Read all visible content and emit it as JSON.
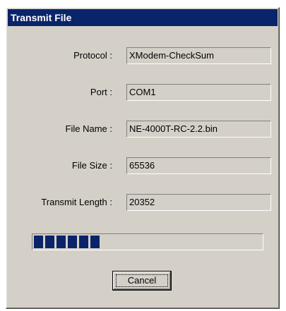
{
  "window": {
    "title": "Transmit File"
  },
  "fields": {
    "protocol": {
      "label": "Protocol :",
      "value": "XModem-CheckSum"
    },
    "port": {
      "label": "Port :",
      "value": "COM1"
    },
    "file_name": {
      "label": "File Name :",
      "value": "NE-4000T-RC-2.2.bin"
    },
    "file_size": {
      "label": "File Size :",
      "value": "65536"
    },
    "transmit_length": {
      "label": "Transmit Length :",
      "value": "20352"
    }
  },
  "progress": {
    "fraction": 0.31,
    "color": "#0a246a"
  },
  "buttons": {
    "cancel_label": "Cancel"
  },
  "colors": {
    "title_bar": "#0a246a",
    "dialog_face": "#d4d0c8"
  }
}
